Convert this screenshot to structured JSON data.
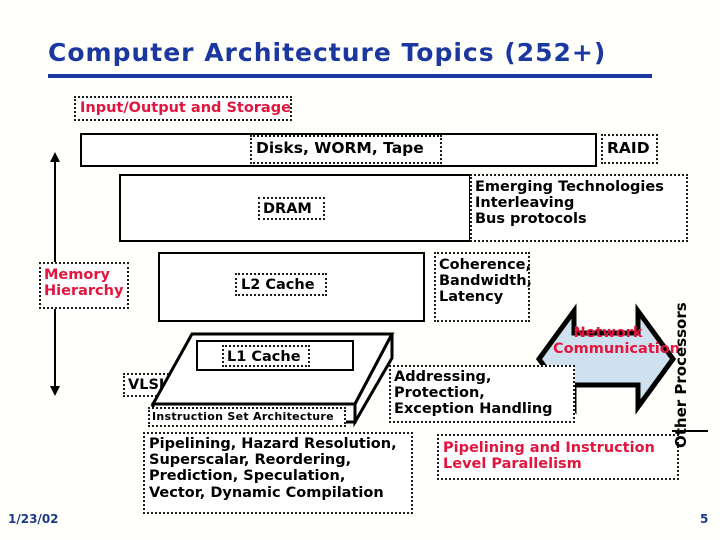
{
  "slide": {
    "title": "Computer Architecture Topics (252+)",
    "date": "1/23/02",
    "page_number": "5",
    "colors": {
      "title_blue": "#1b37a0",
      "accent_red": "#e2153f",
      "footer_blue": "#1b3a8c",
      "arrow_fill": "#cfe0ee",
      "box_border": "#000000"
    }
  },
  "labels": {
    "io_storage": "Input/Output and Storage",
    "disks": "Disks, WORM, Tape",
    "raid": "RAID",
    "dram": "DRAM",
    "emerging": "Emerging Technologies\nInterleaving\nBus protocols",
    "memory_hierarchy": "Memory\nHierarchy",
    "l2_cache": "L2 Cache",
    "coherence": "Coherence,\nBandwidth,\nLatency",
    "network_communication": "Network\nCommunication",
    "vlsi": "VLSI",
    "l1_cache": "L1 Cache",
    "isa": "Instruction Set Architecture",
    "addressing": "Addressing,\nProtection,\nException Handling",
    "pipelining_list": "Pipelining, Hazard Resolution,\nSuperscalar, Reordering,\nPrediction, Speculation,\nVector, Dynamic Compilation",
    "ilp": "Pipelining and Instruction\nLevel Parallelism",
    "other_processors": "Other Processors"
  }
}
